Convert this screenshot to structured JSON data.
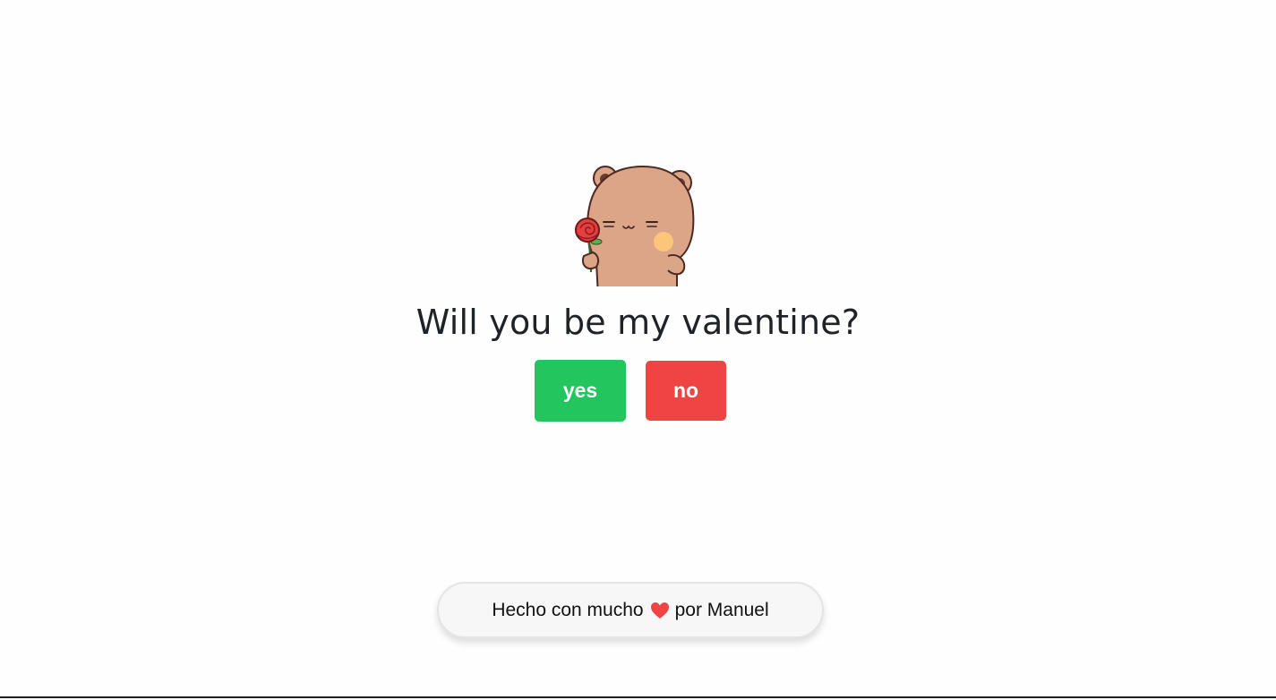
{
  "question": "Will you be my valentine?",
  "buttons": {
    "yes_label": "yes",
    "no_label": "no"
  },
  "footer": {
    "prefix": "Hecho con mucho",
    "suffix": "por Manuel"
  },
  "colors": {
    "yes": "#22c55e",
    "no": "#ef4444",
    "heart": "#ef4444",
    "bear": "#dca587"
  },
  "icons": {
    "illustration": "bear-with-rose-icon",
    "footer_heart": "heart-icon"
  }
}
